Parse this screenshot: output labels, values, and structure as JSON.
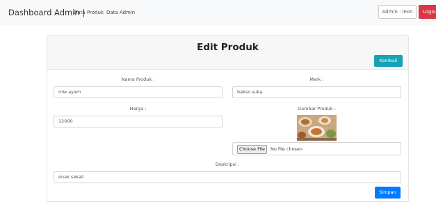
{
  "navbar": {
    "brand": "Dashboard Admin |",
    "links": [
      "Data Produk",
      "Data Admin"
    ],
    "admin_label": "Admin : leon",
    "logout_label": "Logout"
  },
  "card": {
    "title": "Edit Produk",
    "back_label": "Kembali",
    "save_label": "Simpan"
  },
  "form": {
    "nama_label": "Nama Produk :",
    "nama_value": "mie ayam",
    "merk_label": "Merk :",
    "merk_value": "bakso suka",
    "harga_label": "Harga :",
    "harga_value": "12000",
    "gambar_label": "Gambar Produk :",
    "file_button": "Choose File",
    "file_status": "No file chosen",
    "deskripsi_label": "Deskripsi :",
    "deskripsi_value": "enak sekali"
  },
  "colors": {
    "danger": "#dc3545",
    "info": "#17a2b8",
    "primary": "#007bff"
  }
}
